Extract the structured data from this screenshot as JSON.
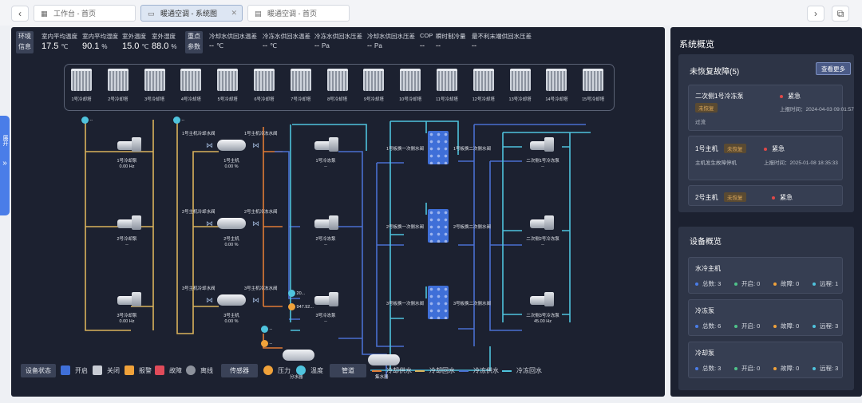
{
  "tabs": [
    {
      "label": "工作台 - 首页",
      "icon": "grid-icon"
    },
    {
      "label": "暖通空调 - 系统图",
      "icon": "monitor-icon"
    },
    {
      "label": "暖通空调 - 首页",
      "icon": "page-icon"
    }
  ],
  "sidebar_handle": {
    "label": "展开"
  },
  "env": {
    "tag_env": [
      "环境",
      "信息"
    ],
    "tag_key": [
      "重点",
      "参数"
    ],
    "metrics": [
      {
        "label": "室内平均温度",
        "value": "17.5",
        "unit": "℃"
      },
      {
        "label": "室内平均湿度",
        "value": "90.1",
        "unit": "%"
      },
      {
        "label": "室外温度",
        "value": "15.0",
        "unit": "℃"
      },
      {
        "label": "室外湿度",
        "value": "88.0",
        "unit": "%"
      }
    ],
    "key_params": [
      {
        "label": "冷却水供回水温差",
        "value": "--",
        "unit": "℃"
      },
      {
        "label": "冷冻水供回水温差",
        "value": "--",
        "unit": "℃"
      },
      {
        "label": "冷冻水供回水压差",
        "value": "--",
        "unit": "Pa"
      },
      {
        "label": "冷却水供回水压差",
        "value": "--",
        "unit": "Pa"
      },
      {
        "label": "COP",
        "value": "--",
        "unit": ""
      },
      {
        "label": "瞬时制冷量",
        "value": "--",
        "unit": ""
      },
      {
        "label": "最不利末端供回水压差",
        "value": "--",
        "unit": ""
      }
    ]
  },
  "towers": [
    "1号冷却塔",
    "2号冷却塔",
    "3号冷却塔",
    "4号冷却塔",
    "5号冷却塔",
    "6号冷却塔",
    "7号冷却塔",
    "8号冷却塔",
    "9号冷却塔",
    "10号冷却塔",
    "11号冷却塔",
    "12号冷却塔",
    "13号冷却塔",
    "14号冷却塔",
    "15号冷却塔"
  ],
  "cooling_pumps": [
    {
      "name": "1号冷却泵",
      "value": "0.00 Hz"
    },
    {
      "name": "2号冷却泵",
      "value": "--"
    },
    {
      "name": "3号冷却泵",
      "value": "0.00 Hz"
    }
  ],
  "chillers": [
    {
      "name": "1号主机",
      "value": "0.00 %",
      "valve_a": "1号主机冷却水阀",
      "valve_b": "1号主机冷冻水阀"
    },
    {
      "name": "2号主机",
      "value": "0.00 %",
      "valve_a": "2号主机冷却水阀",
      "valve_b": "2号主机冷冻水阀"
    },
    {
      "name": "3号主机",
      "value": "0.00 %",
      "valve_a": "3号主机冷却水阀",
      "valve_b": "3号主机冷冻水阀"
    }
  ],
  "chilled_pumps": [
    {
      "name": "1号冷冻泵",
      "value": "--"
    },
    {
      "name": "2号冷冻泵",
      "value": "--"
    },
    {
      "name": "3号冷冻泵",
      "value": "--"
    }
  ],
  "plates": [
    {
      "valve_a": "1号板换一次侧水阀",
      "valve_b": "1号板换二次侧水阀"
    },
    {
      "valve_a": "2号板换一次侧水阀",
      "valve_b": "2号板换二次侧水阀"
    },
    {
      "valve_a": "3号板换一次侧水阀",
      "valve_b": "3号板换二次侧水阀"
    }
  ],
  "secondary_pumps": [
    {
      "name": "二次侧1号冷冻泵",
      "value": "--"
    },
    {
      "name": "二次侧2号冷冻泵",
      "value": "--"
    },
    {
      "name": "二次侧3号冷冻泵",
      "value": "45.00 Hz"
    }
  ],
  "sensors": {
    "s1": "--",
    "s2": "--",
    "s3": "--",
    "s4": "--",
    "s5": "20...",
    "s6": "947.92..."
  },
  "headers": {
    "supply": "分水器",
    "collect": "集水器"
  },
  "legend": {
    "status_tag": "设备状态",
    "status": [
      {
        "label": "开启",
        "color": "#3f6fd8"
      },
      {
        "label": "关闭",
        "color": "#c8ccd4"
      },
      {
        "label": "报警",
        "color": "#f0a23a"
      },
      {
        "label": "故障",
        "color": "#e04b5a"
      },
      {
        "label": "离线",
        "color": "#8d929c"
      }
    ],
    "sensor_tag": "传感器",
    "sensors": [
      {
        "label": "压力",
        "color": "#f0a23a"
      },
      {
        "label": "温度",
        "color": "#4fc3dd"
      }
    ],
    "pipe_tag": "管道",
    "pipes": [
      {
        "label": "冷却供水",
        "color": "#e07b35"
      },
      {
        "label": "冷却回水",
        "color": "#d9b25a"
      },
      {
        "label": "冷冻供水",
        "color": "#4a6fd0"
      },
      {
        "label": "冷冻回水",
        "color": "#4fc3dd"
      }
    ]
  },
  "side": {
    "title": "系统概览",
    "faults_title": "未恢复故障(5)",
    "more_label": "查看更多",
    "faults": [
      {
        "name": "二次侧1号冷冻泵",
        "badge": "未恢复",
        "level": "紧急",
        "time_label": "上报时间：",
        "time": "2024-04-03 09:01:57",
        "desc": "过流"
      },
      {
        "name": "1号主机",
        "badge": "未恢复",
        "level": "紧急",
        "time_label": "上报时间：",
        "time": "2025-01-08 18:35:33",
        "desc": "主机发生故障停机"
      },
      {
        "name": "2号主机",
        "badge": "未恢复",
        "level": "紧急"
      }
    ],
    "devices_title": "设备概览",
    "devices": [
      {
        "name": "水冷主机",
        "total": "总数: 3",
        "on": "开启: 0",
        "fault": "故障: 0",
        "remote": "远程: 1"
      },
      {
        "name": "冷冻泵",
        "total": "总数: 6",
        "on": "开启: 0",
        "fault": "故障: 0",
        "remote": "远程: 3"
      },
      {
        "name": "冷却泵",
        "total": "总数: 3",
        "on": "开启: 0",
        "fault": "故障: 0",
        "remote": "远程: 3"
      }
    ],
    "stat_colors": {
      "total": "#4a7de8",
      "on": "#4fc38a",
      "fault": "#f0a23a",
      "remote": "#4fc3dd"
    }
  }
}
